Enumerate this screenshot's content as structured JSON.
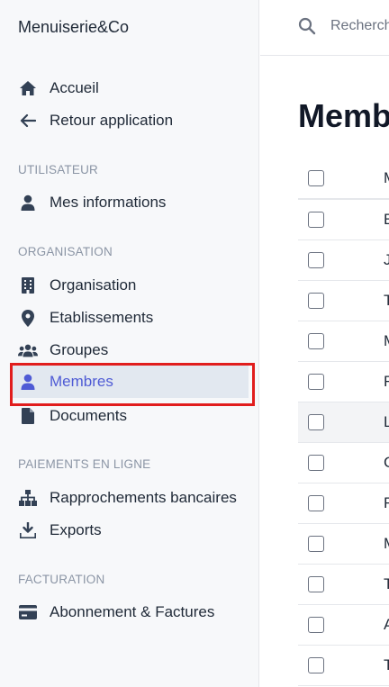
{
  "brand": "Menuiserie&Co",
  "nav": {
    "accueil": "Accueil",
    "retour": "Retour application",
    "utilisateur_label": "UTILISATEUR",
    "mes_informations": "Mes informations",
    "organisation_label": "ORGANISATION",
    "organisation": "Organisation",
    "etablissements": "Etablissements",
    "groupes": "Groupes",
    "membres": "Membres",
    "documents": "Documents",
    "paiements_label": "PAIEMENTS EN LIGNE",
    "rapprochements": "Rapprochements bancaires",
    "exports": "Exports",
    "facturation_label": "FACTURATION",
    "abonnement": "Abonnement & Factures"
  },
  "icons": {
    "accueil": "home-icon",
    "retour": "arrow-left-icon",
    "mes_informations": "user-icon",
    "organisation": "building-icon",
    "etablissements": "map-pin-icon",
    "groupes": "users-icon",
    "membres": "user-icon",
    "documents": "file-icon",
    "rapprochements": "sitemap-icon",
    "exports": "download-icon",
    "abonnement": "credit-card-icon"
  },
  "colors": {
    "accent": "#4f5bd5",
    "active_bg": "#e2e8f0",
    "highlight_border": "#e11d1d",
    "icon": "#334155"
  },
  "search": {
    "placeholder": "Recherch"
  },
  "main": {
    "title": "Memb",
    "header_first_letter": "M",
    "rows": [
      "E",
      "J",
      "T",
      "M",
      "F",
      "L",
      "C",
      "R",
      "M",
      "T",
      "A",
      "T"
    ]
  }
}
